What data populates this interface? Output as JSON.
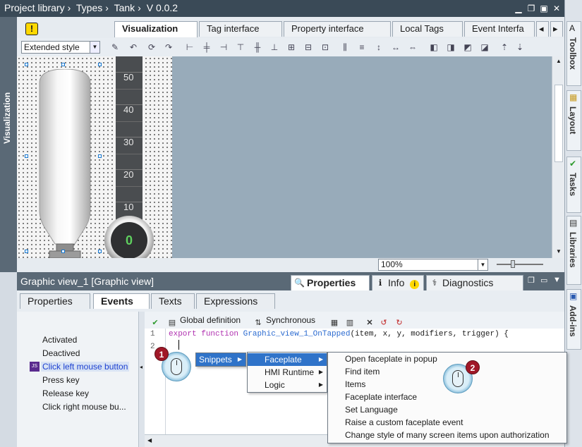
{
  "title_bar": {
    "crumbs": [
      "Project library",
      "Types",
      "Tank",
      "V 0.0.2"
    ]
  },
  "left_bar": {
    "label": "Visualization"
  },
  "right_bar": {
    "tabs": [
      "Toolbox",
      "Layout",
      "Tasks",
      "Libraries",
      "Add-ins"
    ]
  },
  "editor": {
    "tabs": [
      "Visualization",
      "Tag interface",
      "Property interface",
      "Local Tags",
      "Event Interfa"
    ],
    "style_combo": "Extended style",
    "scale_labels": [
      "50",
      "40",
      "30",
      "20",
      "10"
    ],
    "gauge_value": "0",
    "zoom": "100%"
  },
  "properties": {
    "title": "Graphic view_1 [Graphic view]",
    "panel_tabs": [
      "Properties",
      "Info",
      "Diagnostics"
    ],
    "sub_tabs": [
      "Properties",
      "Events",
      "Texts",
      "Expressions"
    ],
    "events": [
      "Activated",
      "Deactived",
      "Click left mouse button",
      "Press key",
      "Release key",
      "Click right mouse bu..."
    ],
    "code_toolbar": {
      "global_definition": "Global definition",
      "synchronous": "Synchronous"
    },
    "code": {
      "line_numbers": [
        "1",
        "2"
      ],
      "line1_keyword1": "export",
      "line1_keyword2": "function",
      "line1_function": "Graphic_view_1_OnTapped",
      "line1_params": "(item, x, y, modifiers, trigger) {"
    }
  },
  "context_menu": {
    "root": "Snippets",
    "level1": [
      "Faceplate",
      "HMI Runtime",
      "Logic"
    ],
    "level2": [
      "Open faceplate in popup",
      "Find item",
      "Items",
      "Faceplate interface",
      "Set Language",
      "Raise a custom faceplate event",
      "Change style of many screen items upon authorization"
    ]
  },
  "callouts": [
    "1",
    "2"
  ],
  "colors": {
    "title_bar": "#3a4a57",
    "panel_header": "#5a6976",
    "menu_highlight": "#2f73c9",
    "canvas_gray": "#98abba",
    "callout": "#a01828"
  }
}
